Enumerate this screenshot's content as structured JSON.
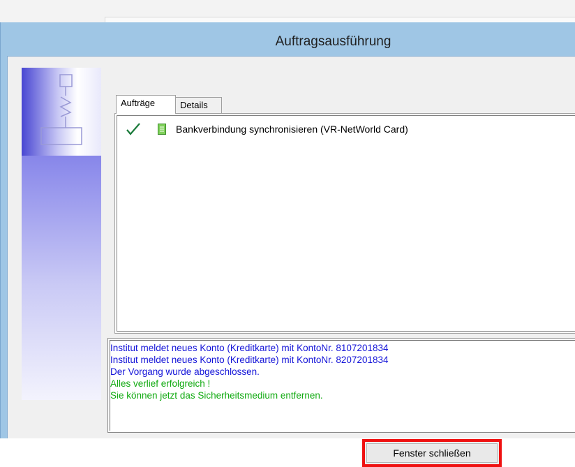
{
  "window": {
    "title": "Auftragsausführung"
  },
  "tabs": [
    {
      "label": "Aufträge",
      "active": true
    },
    {
      "label": "Details",
      "active": false
    }
  ],
  "jobs": [
    {
      "status_icon": "check-icon",
      "type_icon": "document-icon",
      "label": "Bankverbindung synchronisieren (VR-NetWorld Card)"
    }
  ],
  "log": [
    {
      "text": "Institut meldet neues Konto (Kreditkarte) mit KontoNr. 8107201834",
      "color": "#1414d8"
    },
    {
      "text": "Institut meldet neues Konto (Kreditkarte) mit KontoNr. 8207201834",
      "color": "#1414d8"
    },
    {
      "text": "Der Vorgang wurde abgeschlossen.",
      "color": "#1414d8"
    },
    {
      "text": "Alles verlief erfolgreich !",
      "color": "#11aa11"
    },
    {
      "text": "Sie können jetzt das Sicherheitsmedium entfernen.",
      "color": "#11aa11"
    }
  ],
  "buttons": {
    "close_label": "Fenster schließen"
  },
  "colors": {
    "title_bar": "#9fc6e5",
    "highlight_border": "#ef1111",
    "check": "#1a7a3a"
  }
}
